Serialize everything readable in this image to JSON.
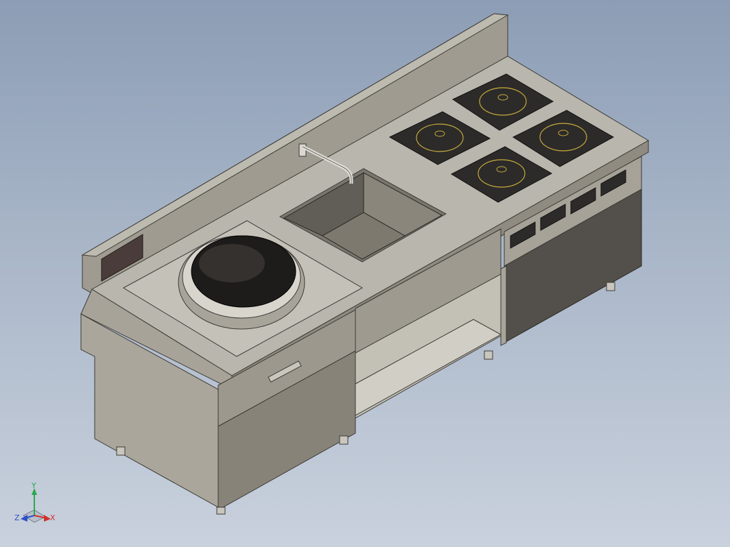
{
  "viewport": {
    "background_top": "#8c9db5",
    "background_bottom": "#c9d1dd"
  },
  "model": {
    "body_color": "#a39f93",
    "top_color": "#b6b3aa",
    "shadow_color": "#6f6b63",
    "dark_color": "#4e4b47",
    "hob_color": "#2c2b2a",
    "ring_color": "#c7a93a",
    "burner_count": 4,
    "control_panel_count": 4
  },
  "triad": {
    "x_label": "X",
    "y_label": "Y",
    "z_label": "Z",
    "x_color": "#d0312d",
    "y_color": "#2aa84a",
    "z_color": "#2e4fc6"
  }
}
